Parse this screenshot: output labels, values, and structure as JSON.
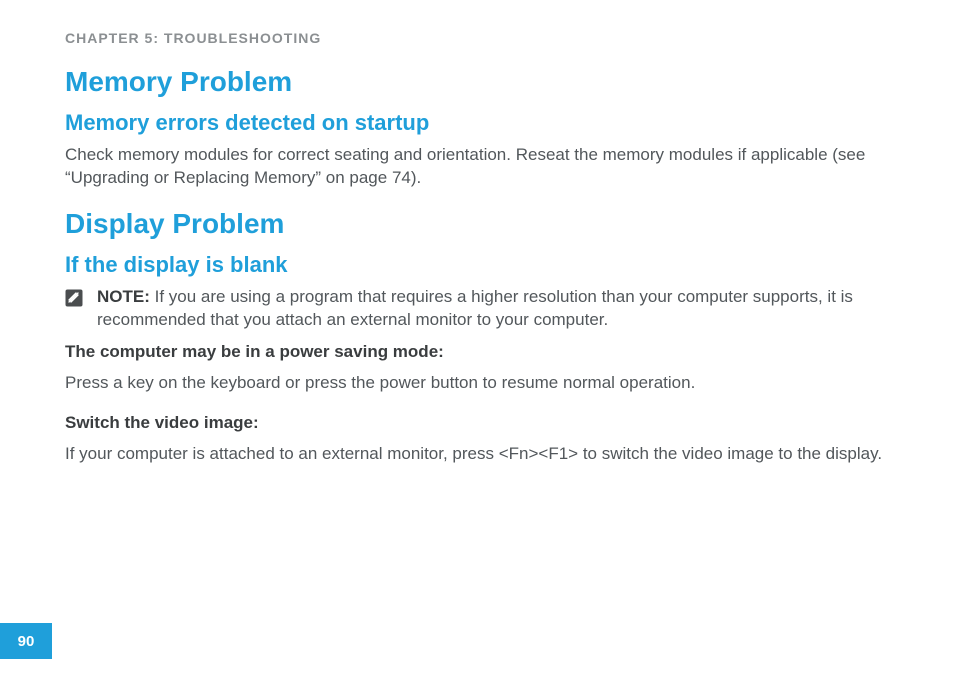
{
  "chapter_heading": "CHAPTER 5: TROUBLESHOOTING",
  "section1": {
    "title": "Memory Problem",
    "subtitle": "Memory errors detected on startup",
    "body": "Check memory modules for correct seating and orientation. Reseat the memory modules if applicable (see “Upgrading or Replacing Memory” on page 74)."
  },
  "section2": {
    "title": "Display Problem",
    "subtitle": "If the display is blank",
    "note_label": "NOTE:",
    "note_text": " If you are using a program that requires a higher resolution than your computer supports, it is recommended that you attach an external monitor to your computer.",
    "bold1": "The computer may be in a power saving mode:",
    "body1": "Press a key on the keyboard or press the power button to resume normal operation.",
    "bold2": "Switch the video image:",
    "body2": "If your computer is attached to an external monitor, press <Fn><F1> to switch the video image to the display."
  },
  "page_number": "90"
}
